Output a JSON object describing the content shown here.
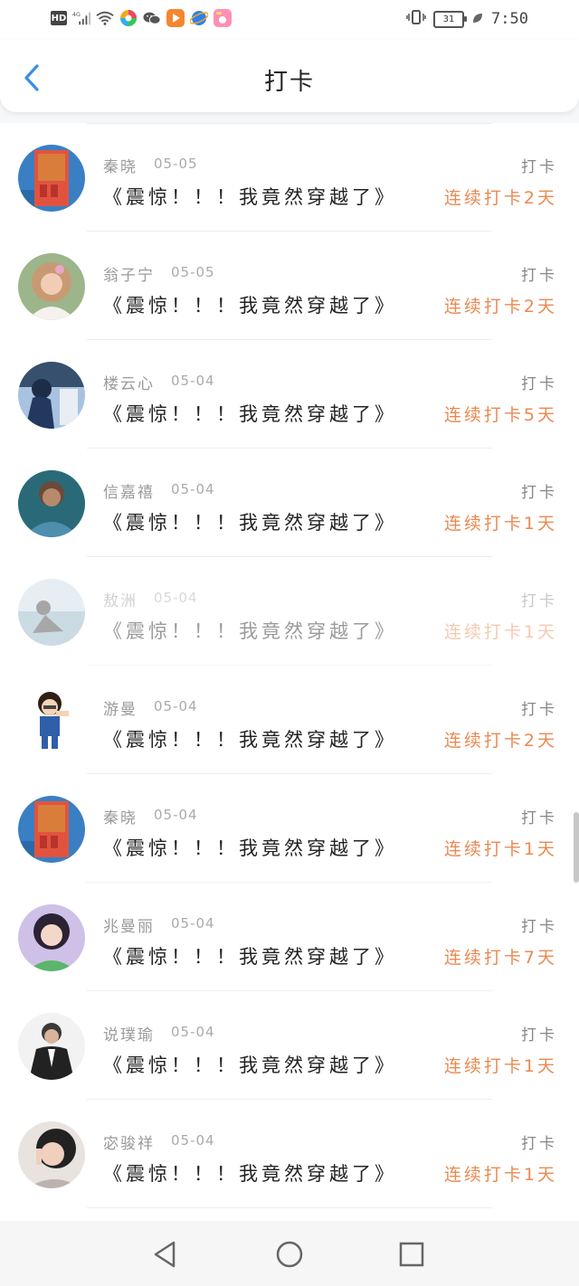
{
  "status_bar": {
    "time": "7:50",
    "battery": "31",
    "network": "4G",
    "hd": "HD",
    "icons": [
      "signal-icon",
      "wifi-icon",
      "app-icon",
      "wechat-icon",
      "video-app-icon",
      "browser-icon",
      "photo-app-icon"
    ],
    "right_icons": [
      "vibrate-icon",
      "battery-icon",
      "leaf-icon"
    ]
  },
  "header": {
    "title": "打卡",
    "back_icon": "back-chevron-icon"
  },
  "checkins": [
    {
      "name": "秦晓",
      "date": "05-05",
      "title": "《震惊！！！我竟然穿越了》",
      "tag": "打卡",
      "streak": "连续打卡2天",
      "avatar": "avatar-1",
      "faded": false
    },
    {
      "name": "翁子宁",
      "date": "05-05",
      "title": "《震惊！！！我竟然穿越了》",
      "tag": "打卡",
      "streak": "连续打卡2天",
      "avatar": "avatar-2",
      "faded": false
    },
    {
      "name": "楼云心",
      "date": "05-04",
      "title": "《震惊！！！我竟然穿越了》",
      "tag": "打卡",
      "streak": "连续打卡5天",
      "avatar": "avatar-3",
      "faded": false
    },
    {
      "name": "信嘉禧",
      "date": "05-04",
      "title": "《震惊！！！我竟然穿越了》",
      "tag": "打卡",
      "streak": "连续打卡1天",
      "avatar": "avatar-4",
      "faded": false
    },
    {
      "name": "敖洲",
      "date": "05-04",
      "title": "《震惊！！！我竟然穿越了》",
      "tag": "打卡",
      "streak": "连续打卡1天",
      "avatar": "avatar-5",
      "faded": true
    },
    {
      "name": "游曼",
      "date": "05-04",
      "title": "《震惊！！！我竟然穿越了》",
      "tag": "打卡",
      "streak": "连续打卡2天",
      "avatar": "avatar-6",
      "faded": false
    },
    {
      "name": "秦晓",
      "date": "05-04",
      "title": "《震惊！！！我竟然穿越了》",
      "tag": "打卡",
      "streak": "连续打卡1天",
      "avatar": "avatar-7",
      "faded": false
    },
    {
      "name": "兆曼丽",
      "date": "05-04",
      "title": "《震惊！！！我竟然穿越了》",
      "tag": "打卡",
      "streak": "连续打卡7天",
      "avatar": "avatar-8",
      "faded": false
    },
    {
      "name": "说璞瑜",
      "date": "05-04",
      "title": "《震惊！！！我竟然穿越了》",
      "tag": "打卡",
      "streak": "连续打卡1天",
      "avatar": "avatar-9",
      "faded": false
    },
    {
      "name": "宓骏祥",
      "date": "05-04",
      "title": "《震惊！！！我竟然穿越了》",
      "tag": "打卡",
      "streak": "连续打卡1天",
      "avatar": "avatar-10",
      "faded": false
    }
  ],
  "nav_bar": {
    "back_icon": "nav-back-icon",
    "home_icon": "nav-home-icon",
    "recents_icon": "nav-recents-icon"
  },
  "colors": {
    "accent_back": "#3a8ee6",
    "streak": "#e98a52"
  }
}
